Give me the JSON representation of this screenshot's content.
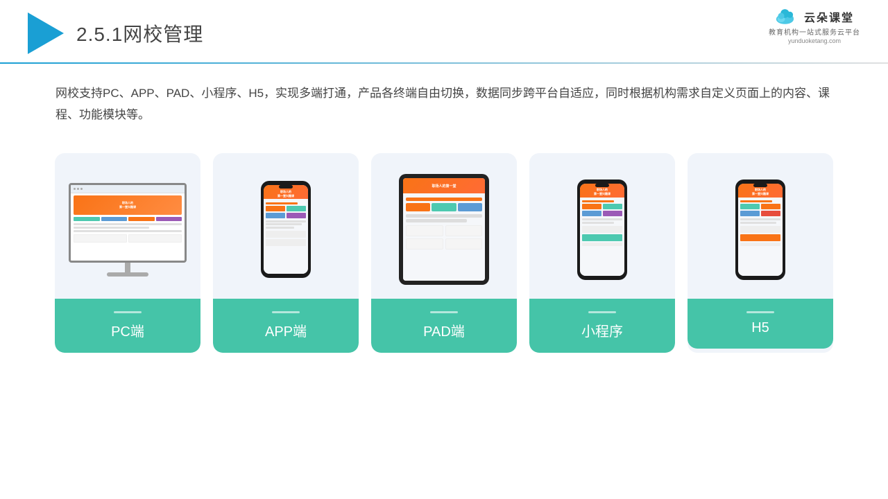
{
  "header": {
    "title": "2.5.1网校管理",
    "title_num": "2.5.1",
    "title_text": "网校管理"
  },
  "brand": {
    "name": "云朵课堂",
    "tagline": "教育机构一站\n式服务云平台",
    "url": "yunduoketang.com"
  },
  "description": {
    "text": "网校支持PC、APP、PAD、小程序、H5，实现多端打通，产品各终端自由切换，数据同步跨平台自适应，同时根据机构需求自定义页面上的内容、课程、功能模块等。"
  },
  "cards": [
    {
      "id": "pc",
      "label": "PC端"
    },
    {
      "id": "app",
      "label": "APP端"
    },
    {
      "id": "pad",
      "label": "PAD端"
    },
    {
      "id": "miniprogram",
      "label": "小程序"
    },
    {
      "id": "h5",
      "label": "H5"
    }
  ],
  "colors": {
    "accent": "#45c4a8",
    "blue": "#1a9fd4",
    "orange": "#f97316"
  }
}
